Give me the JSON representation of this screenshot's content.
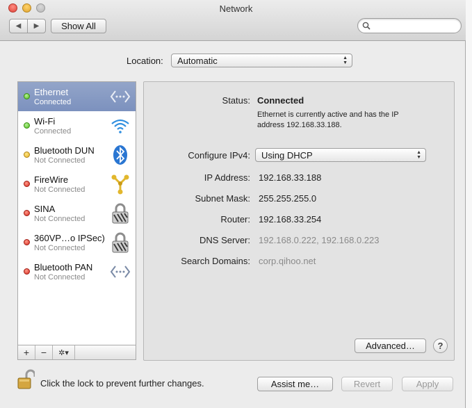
{
  "window": {
    "title": "Network"
  },
  "toolbar": {
    "back_label": "◀",
    "forward_label": "▶",
    "show_all_label": "Show All",
    "search_placeholder": ""
  },
  "location": {
    "label": "Location:",
    "value": "Automatic"
  },
  "services": [
    {
      "name": "Ethernet",
      "status": "Connected",
      "indicator": "green",
      "icon": "ethernet-icon",
      "selected": true
    },
    {
      "name": "Wi-Fi",
      "status": "Connected",
      "indicator": "green",
      "icon": "wifi-icon",
      "selected": false
    },
    {
      "name": "Bluetooth DUN",
      "status": "Not Connected",
      "indicator": "yellow",
      "icon": "bluetooth-icon",
      "selected": false
    },
    {
      "name": "FireWire",
      "status": "Not Connected",
      "indicator": "red",
      "icon": "firewire-icon",
      "selected": false
    },
    {
      "name": "SINA",
      "status": "Not Connected",
      "indicator": "red",
      "icon": "vpn-lock-icon",
      "selected": false
    },
    {
      "name": "360VP…o IPSec)",
      "status": "Not Connected",
      "indicator": "red",
      "icon": "vpn-lock-icon",
      "selected": false
    },
    {
      "name": "Bluetooth PAN",
      "status": "Not Connected",
      "indicator": "red",
      "icon": "bluetooth-pan-icon",
      "selected": false
    }
  ],
  "sidebar_tools": {
    "add": "+",
    "remove": "−",
    "gear": "✲▾"
  },
  "detail": {
    "status_label": "Status:",
    "status_value": "Connected",
    "status_desc": "Ethernet is currently active and has the IP address 192.168.33.188.",
    "configure_label": "Configure IPv4:",
    "configure_value": "Using DHCP",
    "ip_label": "IP Address:",
    "ip_value": "192.168.33.188",
    "subnet_label": "Subnet Mask:",
    "subnet_value": "255.255.255.0",
    "router_label": "Router:",
    "router_value": "192.168.33.254",
    "dns_label": "DNS Server:",
    "dns_value": "192.168.0.222, 192.168.0.223",
    "domains_label": "Search Domains:",
    "domains_value": "corp.qihoo.net",
    "advanced_label": "Advanced…",
    "help_label": "?"
  },
  "footer": {
    "lock_text": "Click the lock to prevent further changes.",
    "assist_label": "Assist me…",
    "revert_label": "Revert",
    "apply_label": "Apply"
  },
  "colors": {
    "selected_row": "#7c91be",
    "connected": "#4cbb17",
    "not_connected_yellow": "#e5b321",
    "not_connected_red": "#d62a1e"
  }
}
